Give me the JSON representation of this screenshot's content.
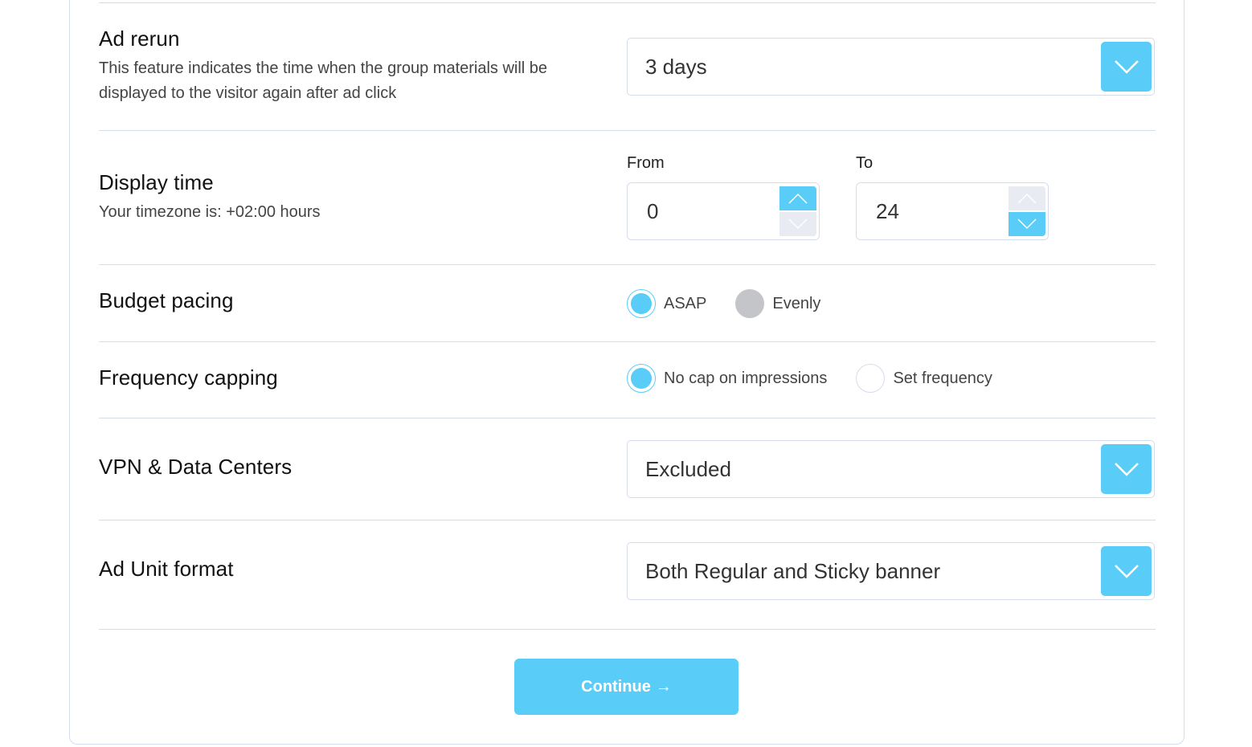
{
  "colors": {
    "accent": "#59cdf7",
    "border": "#d6dceb",
    "inactive_spin": "#e8ebf2",
    "disabled_radio": "#c4c5c9"
  },
  "ad_rerun": {
    "title": "Ad rerun",
    "description": "This feature indicates the time when the group materials will be displayed to the visitor again after ad click",
    "selected": "3 days",
    "dropdown_icon": "chevron-down-icon"
  },
  "display_time": {
    "title": "Display time",
    "timezone": "Your timezone is: +02:00 hours",
    "from_label": "From",
    "from_value": "0",
    "to_label": "To",
    "to_value": "24"
  },
  "budget_pacing": {
    "title": "Budget pacing",
    "options": [
      {
        "label": "ASAP",
        "state": "checked"
      },
      {
        "label": "Evenly",
        "state": "disabled"
      }
    ]
  },
  "frequency_capping": {
    "title": "Frequency capping",
    "options": [
      {
        "label": "No cap on impressions",
        "state": "checked"
      },
      {
        "label": "Set frequency",
        "state": "unchecked"
      }
    ]
  },
  "vpn": {
    "title": "VPN & Data Centers",
    "selected": "Excluded"
  },
  "ad_unit_format": {
    "title": "Ad Unit format",
    "selected": "Both Regular and Sticky banner"
  },
  "continue_button": {
    "label": "Continue",
    "icon": "arrow-right-icon",
    "arrow": "→"
  }
}
